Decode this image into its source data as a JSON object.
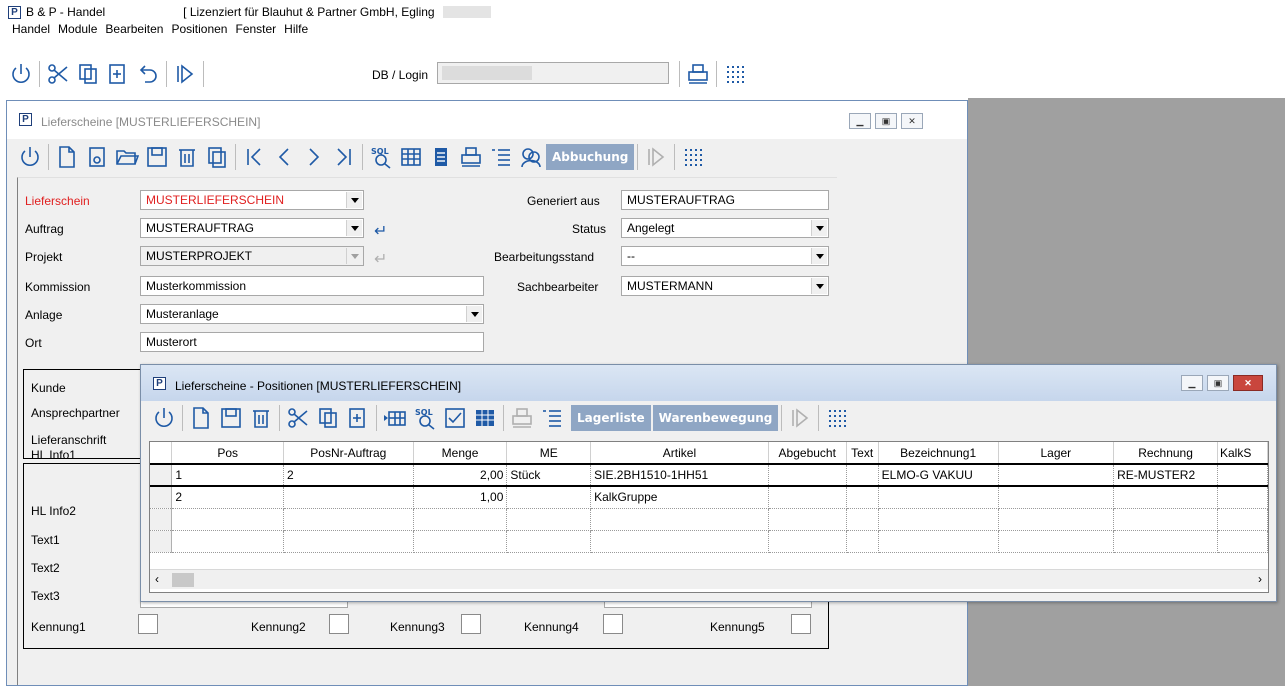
{
  "app": {
    "logo_letter": "P",
    "title": "B & P - Handel",
    "license": "[ Lizenziert für Blauhut & Partner GmbH, Egling",
    "db_login_label": "DB / Login"
  },
  "menu": [
    "Handel",
    "Module",
    "Bearbeiten",
    "Positionen",
    "Fenster",
    "Hilfe"
  ],
  "lieferscheine": {
    "title": "Lieferscheine [MUSTERLIEFERSCHEIN]",
    "abbuchung_label": "Abbuchung",
    "fields": {
      "lieferschein": {
        "label": "Lieferschein",
        "value": "MUSTERLIEFERSCHEIN"
      },
      "auftrag": {
        "label": "Auftrag",
        "value": "MUSTERAUFTRAG"
      },
      "projekt": {
        "label": "Projekt",
        "value": "MUSTERPROJEKT"
      },
      "kommission": {
        "label": "Kommission",
        "value": "Musterkommission"
      },
      "anlage": {
        "label": "Anlage",
        "value": "Musteranlage"
      },
      "ort": {
        "label": "Ort",
        "value": "Musterort"
      },
      "generiert_aus": {
        "label": "Generiert aus",
        "value": "MUSTERAUFTRAG"
      },
      "status": {
        "label": "Status",
        "value": "Angelegt"
      },
      "bearbeitungsstand": {
        "label": "Bearbeitungsstand",
        "value": "--"
      },
      "sachbearbeiter": {
        "label": "Sachbearbeiter",
        "value": "MUSTERMANN"
      }
    },
    "kunde_labels": {
      "kunde": "Kunde",
      "ansprechpartner": "Ansprechpartner",
      "lieferanschrift": "Lieferanschrift"
    },
    "info_labels": {
      "hl_info1": "HL Info1",
      "hl_info2": "HL Info2",
      "text1": "Text1",
      "text2": "Text2",
      "text3": "Text3"
    },
    "kennungen": [
      "Kennung1",
      "Kennung2",
      "Kennung3",
      "Kennung4",
      "Kennung5"
    ]
  },
  "positionen": {
    "title": "Lieferscheine - Positionen [MUSTERLIEFERSCHEIN]",
    "lagerliste_label": "Lagerliste",
    "warenbewegung_label": "Warenbewegung",
    "columns": [
      "Pos",
      "PosNr-Auftrag",
      "Menge",
      "ME",
      "Artikel",
      "Abgebucht",
      "Text",
      "Bezeichnung1",
      "Lager",
      "Rechnung",
      "KalkS"
    ],
    "rows": [
      [
        "1",
        "2",
        "2,00",
        "Stück",
        "SIE.2BH1510-1HH51",
        "",
        "",
        "ELMO-G VAKUU",
        "",
        "RE-MUSTER2",
        ""
      ],
      [
        "2",
        "",
        "1,00",
        "",
        "KalkGruppe",
        "",
        "",
        "",
        "",
        "",
        ""
      ]
    ]
  },
  "colors": {
    "accent": "#1f5aa6",
    "required_label": "#e02020",
    "button_fill": "#8fa6c4"
  }
}
